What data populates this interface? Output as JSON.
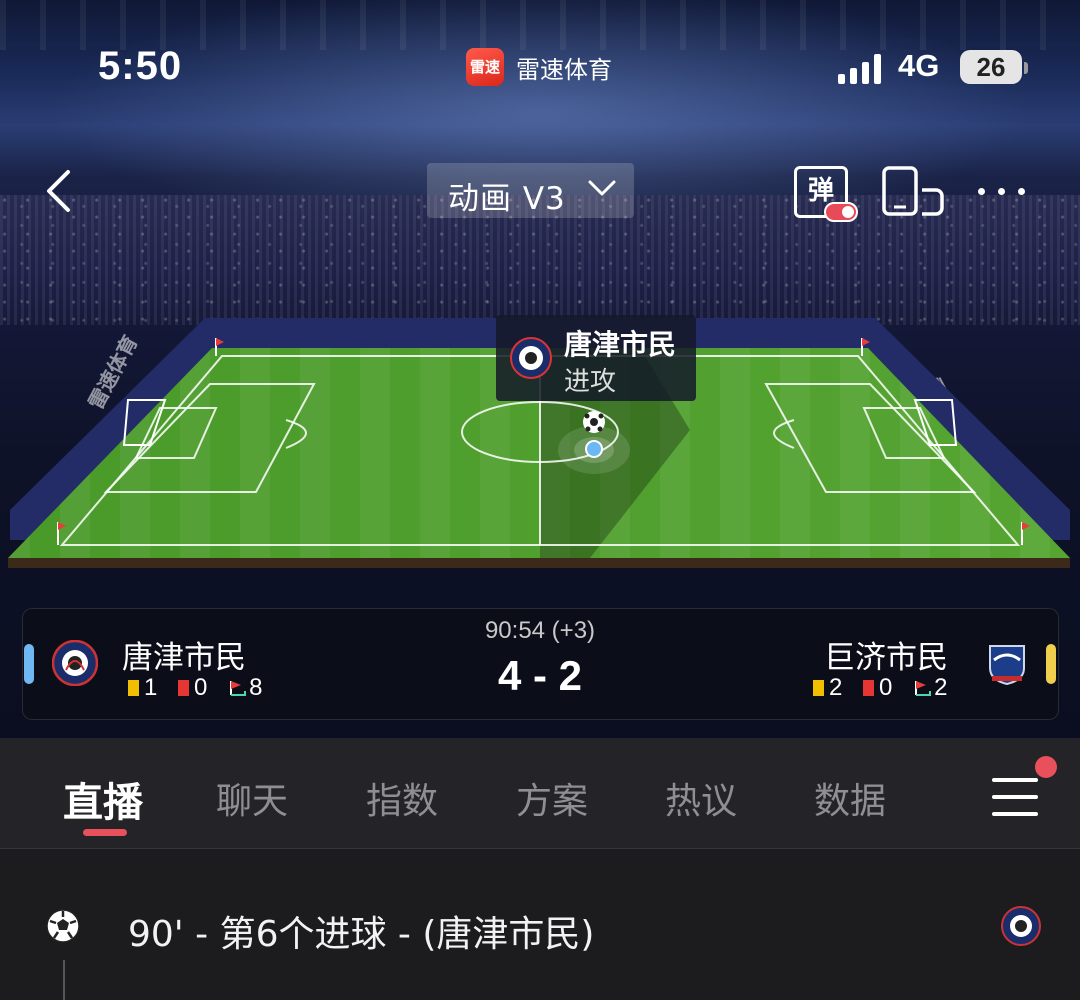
{
  "status_bar": {
    "time": "5:50",
    "app_name": "雷速体育",
    "app_badge": "雷速",
    "network": "4G",
    "battery": "26"
  },
  "header": {
    "mode_label": "动画 V3",
    "danmu_label": "弹"
  },
  "pitch": {
    "board_ad": "雷速体育",
    "event_popup": {
      "team": "唐津市民",
      "action": "进攻"
    }
  },
  "match": {
    "clock": "90:54 (+3)",
    "score": "4 - 2",
    "home": {
      "name": "唐津市民",
      "yellow_cards": "1",
      "red_cards": "0",
      "corners": "8",
      "color": "#6fb8f4"
    },
    "away": {
      "name": "巨济市民",
      "yellow_cards": "2",
      "red_cards": "0",
      "corners": "2",
      "color": "#f0cf4c"
    }
  },
  "tabs": [
    {
      "label": "直播",
      "active": true
    },
    {
      "label": "聊天"
    },
    {
      "label": "指数"
    },
    {
      "label": "方案"
    },
    {
      "label": "热议"
    },
    {
      "label": "数据"
    }
  ],
  "feed": {
    "events": [
      {
        "text": "90' - 第6个进球 - (唐津市民)",
        "icon": "soccer-ball-icon"
      }
    ]
  },
  "colors": {
    "accent": "#e8505b",
    "pitch_green": "#4c9a2e"
  }
}
